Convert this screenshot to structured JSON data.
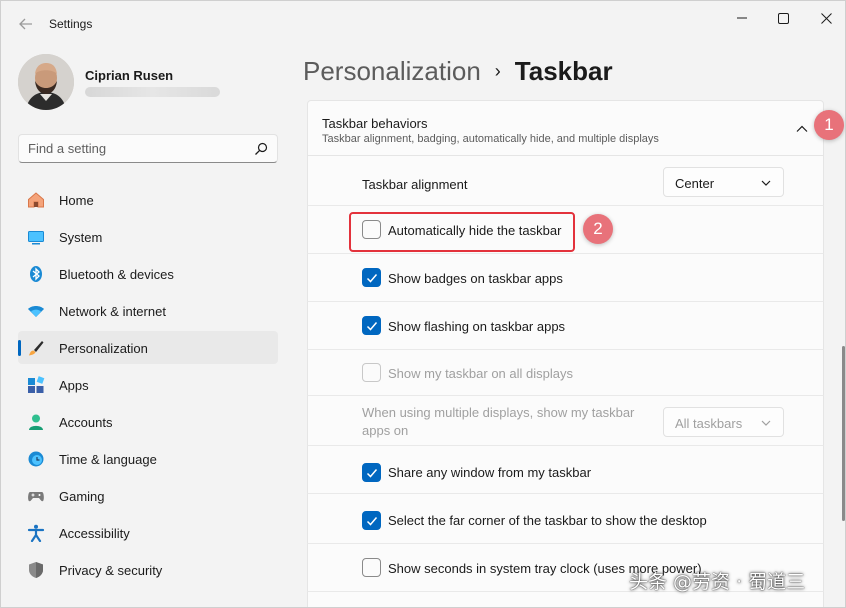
{
  "window": {
    "app_title": "Settings"
  },
  "profile": {
    "name": "Ciprian Rusen"
  },
  "search": {
    "placeholder": "Find a setting"
  },
  "sidebar": {
    "items": [
      {
        "label": "Home",
        "icon": "home-icon"
      },
      {
        "label": "System",
        "icon": "system-icon"
      },
      {
        "label": "Bluetooth & devices",
        "icon": "bluetooth-icon"
      },
      {
        "label": "Network & internet",
        "icon": "wifi-icon"
      },
      {
        "label": "Personalization",
        "icon": "brush-icon",
        "active": true
      },
      {
        "label": "Apps",
        "icon": "apps-icon"
      },
      {
        "label": "Accounts",
        "icon": "accounts-icon"
      },
      {
        "label": "Time & language",
        "icon": "time-language-icon"
      },
      {
        "label": "Gaming",
        "icon": "gaming-icon"
      },
      {
        "label": "Accessibility",
        "icon": "accessibility-icon"
      },
      {
        "label": "Privacy & security",
        "icon": "shield-icon"
      }
    ]
  },
  "breadcrumb": {
    "parent": "Personalization",
    "separator": "›",
    "current": "Taskbar"
  },
  "section": {
    "title": "Taskbar behaviors",
    "description": "Taskbar alignment, badging, automatically hide, and multiple displays"
  },
  "settings": {
    "alignment_label": "Taskbar alignment",
    "alignment_value": "Center",
    "auto_hide": {
      "label": "Automatically hide the taskbar",
      "checked": false
    },
    "badges": {
      "label": "Show badges on taskbar apps",
      "checked": true
    },
    "flashing": {
      "label": "Show flashing on taskbar apps",
      "checked": true
    },
    "all_displays": {
      "label": "Show my taskbar on all displays",
      "checked": false,
      "disabled": true
    },
    "multi_display_label": "When using multiple displays, show my taskbar apps on",
    "multi_display_value": "All taskbars",
    "share_window": {
      "label": "Share any window from my taskbar",
      "checked": true
    },
    "far_corner": {
      "label": "Select the far corner of the taskbar to show the desktop",
      "checked": true
    },
    "seconds": {
      "label": "Show seconds in system tray clock (uses more power)",
      "checked": false
    }
  },
  "annotations": {
    "marker1": "1",
    "marker2": "2"
  },
  "watermark": "头条 @劳资 · 蜀道三",
  "colors": {
    "accent": "#0067c0",
    "marker": "#e8727a",
    "highlight": "#e3323c"
  }
}
